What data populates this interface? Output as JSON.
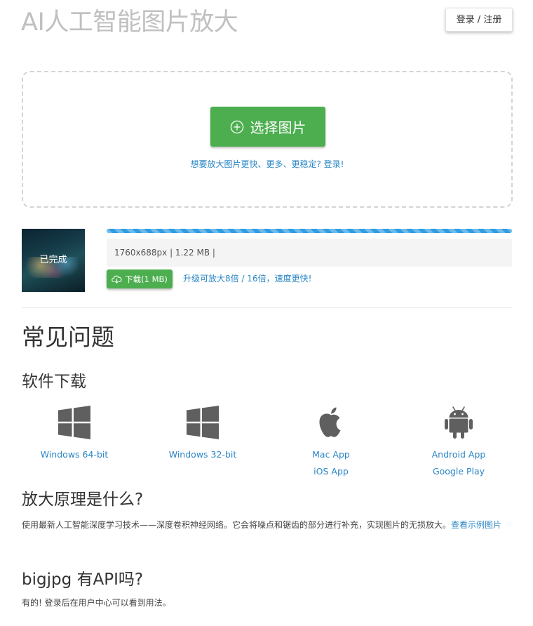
{
  "header": {
    "title": "AI人工智能图片放大",
    "login_label": "登录 / 注册"
  },
  "upload": {
    "select_label": "选择图片",
    "hint_link": "想要放大图片更快、更多、更稳定? 登录!"
  },
  "task": {
    "status": "已完成",
    "progress": 1.0,
    "info": "1760x688px | 1.22 MB |",
    "download_label": "下载(1 MB)",
    "upgrade_link": "升级可放大8倍 / 16倍，速度更快!"
  },
  "faq": {
    "title": "常见问题",
    "software": {
      "heading": "软件下载",
      "items": [
        {
          "icon": "windows-icon",
          "links": [
            "Windows 64-bit"
          ]
        },
        {
          "icon": "windows-icon",
          "links": [
            "Windows 32-bit"
          ]
        },
        {
          "icon": "apple-icon",
          "links": [
            "Mac App",
            "iOS App"
          ]
        },
        {
          "icon": "android-icon",
          "links": [
            "Android App",
            "Google Play"
          ]
        }
      ]
    },
    "principle": {
      "heading": "放大原理是什么?",
      "text": "使用最新人工智能深度学习技术——深度卷积神经网络。它会将噪点和锯齿的部分进行补充，实现图片的无损放大。",
      "link": "查看示例图片"
    },
    "api": {
      "heading": "bigjpg 有API吗?",
      "text": "有的! 登录后在用户中心可以看到用法。"
    }
  },
  "colors": {
    "accent_green": "#4cae4f",
    "link_blue": "#2a86c5",
    "progress_blue": "#2f9ee3",
    "title_gray": "#c0c0c0",
    "icon_gray": "#5f5f5f"
  }
}
